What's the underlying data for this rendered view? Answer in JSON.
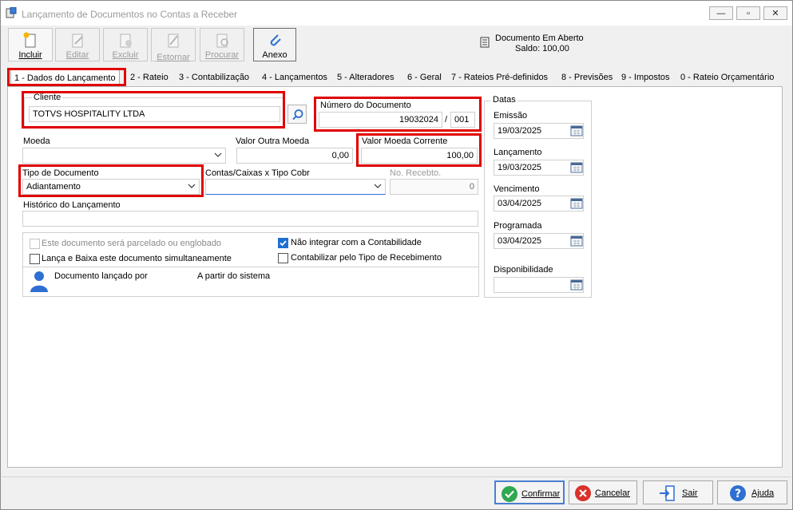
{
  "window": {
    "title": "Lançamento de Documentos no Contas a Receber",
    "controls": {
      "minimize": "—",
      "restore": "▫",
      "close": "✕"
    }
  },
  "toolbar": {
    "incluir": "Incluir",
    "editar": "Editar",
    "excluir": "Excluir",
    "estornar": "Estornar",
    "procurar": "Procurar",
    "anexo": "Anexo"
  },
  "status": {
    "line1": "Documento Em Aberto",
    "line2": "Saldo: 100,00"
  },
  "tabs": [
    {
      "label": "1 - Dados do Lançamento"
    },
    {
      "label": "2 - Rateio"
    },
    {
      "label": "3 - Contabilização"
    },
    {
      "label": "4 - Lançamentos"
    },
    {
      "label": "5 - Alteradores"
    },
    {
      "label": "6 - Geral"
    },
    {
      "label": "7 - Rateios Pré-definidos"
    },
    {
      "label": "8 - Previsões"
    },
    {
      "label": "9 - Impostos"
    },
    {
      "label": "0 - Rateio Orçamentário"
    }
  ],
  "form": {
    "cliente_label": "Cliente",
    "cliente_value": "TOTVS HOSPITALITY LTDA",
    "numero_label": "Número do Documento",
    "numero_value": "19032024",
    "numero_sep": "/",
    "numero_parcela": "001",
    "moeda_label": "Moeda",
    "moeda_value": "",
    "valor_outra_label": "Valor Outra Moeda",
    "valor_outra_value": "0,00",
    "valor_corrente_label": "Valor Moeda Corrente",
    "valor_corrente_value": "100,00",
    "tipo_doc_label": "Tipo de Documento",
    "tipo_doc_value": "Adiantamento",
    "contas_label": "Contas/Caixas x Tipo Cobr",
    "contas_value": "",
    "recebto_label": "No. Recebto.",
    "recebto_value": "0",
    "historico_label": "Histórico do Lançamento",
    "historico_value": "",
    "chk_parcelado": "Este documento será parcelado ou englobado",
    "chk_lanca_baixa": "Lança e Baixa este documento simultaneamente",
    "chk_nao_integrar": "Não integrar com a Contabilidade",
    "chk_contabilizar": "Contabilizar pelo Tipo de Recebimento",
    "lancado_por_label": "Documento lançado por",
    "lancado_por_value": "A partir do sistema"
  },
  "datas": {
    "group_label": "Datas",
    "emissao_label": "Emissão",
    "emissao_value": "19/03/2025",
    "lancamento_label": "Lançamento",
    "lancamento_value": "19/03/2025",
    "vencimento_label": "Vencimento",
    "vencimento_value": "03/04/2025",
    "programada_label": "Programada",
    "programada_value": "03/04/2025",
    "disponibilidade_label": "Disponibilidade",
    "disponibilidade_value": ""
  },
  "buttons": {
    "confirmar": "Confirmar",
    "cancelar": "Cancelar",
    "sair": "Sair",
    "ajuda": "Ajuda"
  },
  "colors": {
    "highlight": "#e00000",
    "confirm": "#2fa84f",
    "cancel": "#d8322b",
    "help": "#2e6fd1",
    "checkbox": "#1f6fd1"
  }
}
